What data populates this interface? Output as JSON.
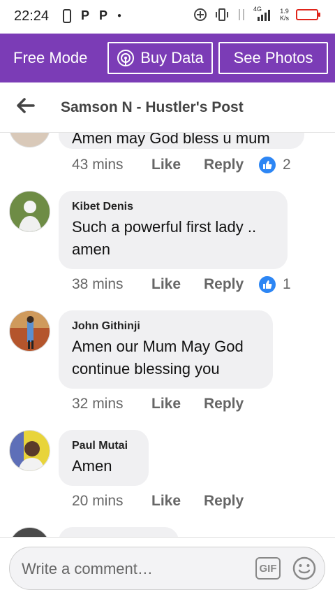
{
  "status_bar": {
    "time": "22:24",
    "network": "4G",
    "speed_value": "1.9",
    "speed_unit": "K/s",
    "battery_color": "#e0251b"
  },
  "promo_bar": {
    "free_mode_label": "Free Mode",
    "buy_data_label": "Buy Data",
    "see_photos_label": "See Photos",
    "background": "#7b3cb6"
  },
  "header": {
    "title": "Samson N - Hustler's Post"
  },
  "comments": [
    {
      "author": "",
      "text": "Amen  may God bless u mum",
      "time": "43 mins",
      "like_label": "Like",
      "reply_label": "Reply",
      "reactions": "2"
    },
    {
      "author": "Kibet Denis",
      "text": "Such a powerful first lady .. amen",
      "time": "38 mins",
      "like_label": "Like",
      "reply_label": "Reply",
      "reactions": "1"
    },
    {
      "author": "John Githinji",
      "text": "Amen our Mum May God continue blessing you",
      "time": "32 mins",
      "like_label": "Like",
      "reply_label": "Reply"
    },
    {
      "author": "Paul Mutai",
      "text": "Amen",
      "time": "20 mins",
      "like_label": "Like",
      "reply_label": "Reply"
    }
  ],
  "composer": {
    "placeholder": "Write a comment…",
    "gif_label": "GIF"
  }
}
